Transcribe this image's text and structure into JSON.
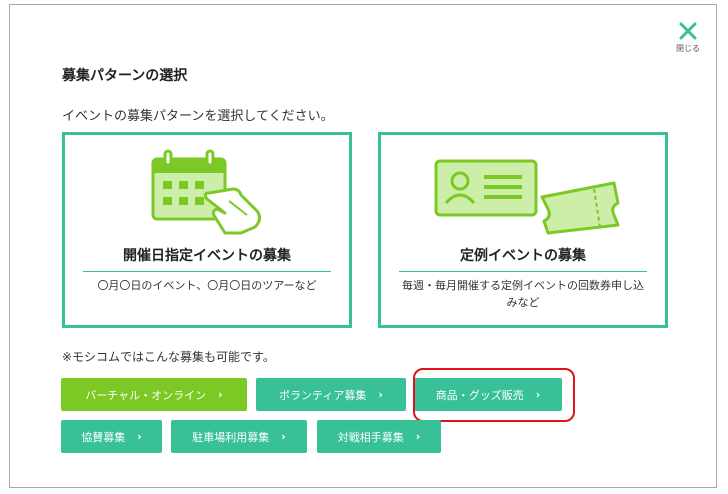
{
  "dialog": {
    "close_label": "閉じる",
    "title": "募集パターンの選択",
    "subtitle": "イベントの募集パターンを選択してください。"
  },
  "cards": [
    {
      "title": "開催日指定イベントの募集",
      "description": "〇月〇日のイベント、〇月〇日のツアーなど",
      "icon": "calendar-hand-icon"
    },
    {
      "title": "定例イベントの募集",
      "description": "毎週・毎月開催する定例イベントの回数券申し込みなど",
      "icon": "ticket-card-icon"
    }
  ],
  "note": "※モシコムではこんな募集も可能です。",
  "other_options": [
    {
      "label": "バーチャル・オンライン",
      "color": "#7cc925"
    },
    {
      "label": "ボランティア募集",
      "color": "#38c196"
    },
    {
      "label": "商品・グッズ販売",
      "color": "#38c196"
    },
    {
      "label": "協賛募集",
      "color": "#38c196"
    },
    {
      "label": "駐車場利用募集",
      "color": "#38c196"
    },
    {
      "label": "対戦相手募集",
      "color": "#38c196"
    }
  ],
  "colors": {
    "accent": "#38c196",
    "lime": "#7cc925",
    "highlight": "#e0121a"
  }
}
